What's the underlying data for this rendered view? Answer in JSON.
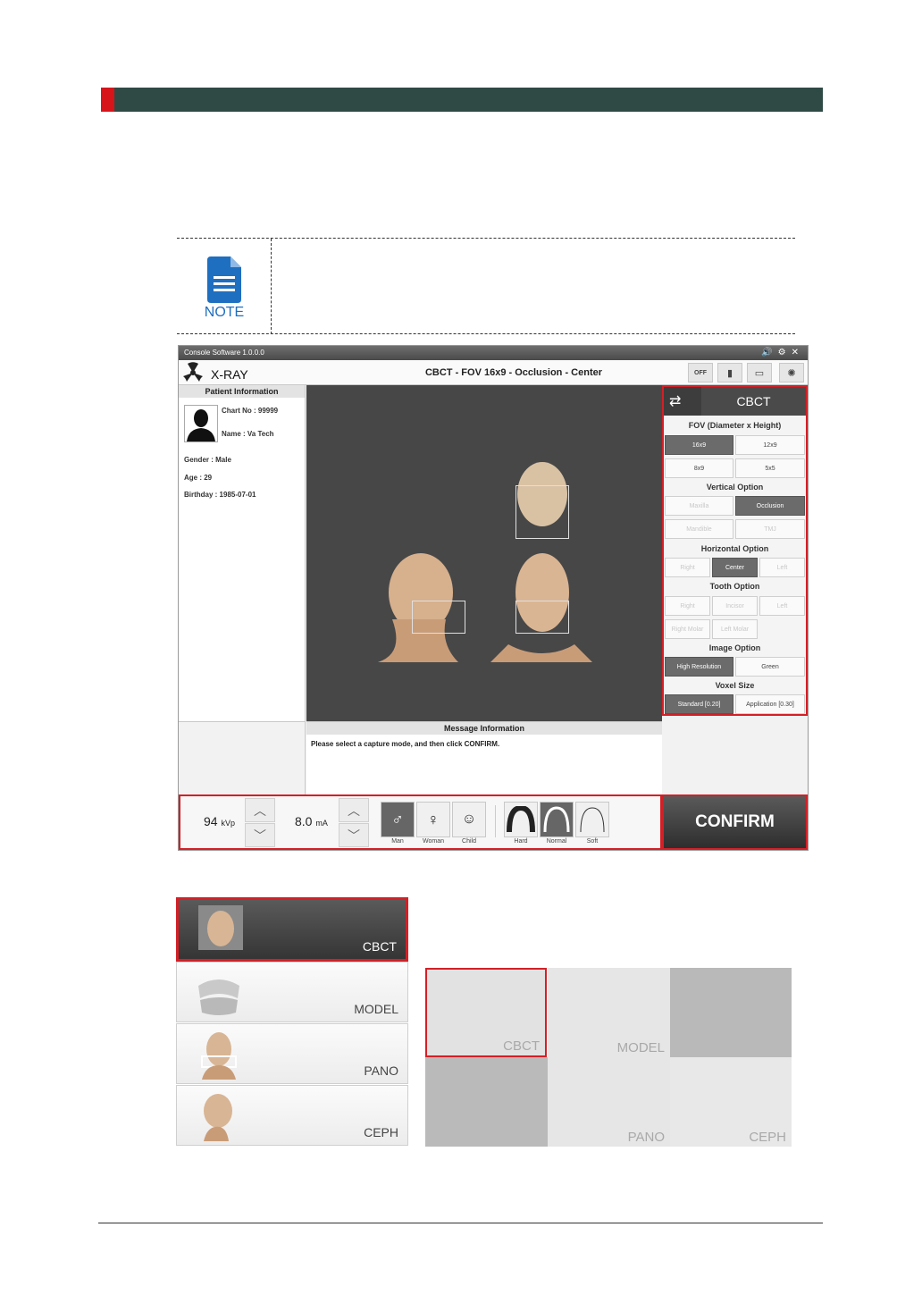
{
  "note": {
    "label": "NOTE"
  },
  "window": {
    "title": "Console Software  1.0.0.0",
    "app_name": "X-RAY",
    "mode_title": "CBCT - FOV 16x9 - Occlusion - Center",
    "header_buttons": [
      "OFF"
    ]
  },
  "patient": {
    "header": "Patient Information",
    "chart": "Chart No : 99999",
    "name": "Name : Va Tech",
    "gender": "Gender : Male",
    "age": "Age : 29",
    "birthday": "Birthday : 1985-07-01"
  },
  "control": {
    "mode": "CBCT",
    "fov_label": "FOV (Diameter x Height)",
    "fov": [
      "16x9",
      "12x9",
      "8x9",
      "5x5"
    ],
    "vertical_label": "Vertical Option",
    "vertical": [
      "Maxilla",
      "Occlusion",
      "Mandible",
      "TMJ"
    ],
    "horizontal_label": "Horizontal Option",
    "horizontal": [
      "Right",
      "Center",
      "Left"
    ],
    "tooth_label": "Tooth Option",
    "tooth": [
      "Right",
      "Incisor",
      "Left",
      "Right Molar",
      "Left Molar"
    ],
    "image_label": "Image Option",
    "image": [
      "High Resolution",
      "Green"
    ],
    "voxel_label": "Voxel Size",
    "voxel": [
      "Standard  [0.20]",
      "Application [0.30]"
    ]
  },
  "message": {
    "header": "Message Information",
    "text": "Please select a capture mode, and then click CONFIRM."
  },
  "bottom": {
    "kvp_value": "94",
    "kvp_unit": "kVp",
    "ma_value": "8.0",
    "ma_unit": "mA",
    "patient_types": [
      "Man",
      "Woman",
      "Child"
    ],
    "arch_types": [
      "Hard",
      "Normal",
      "Soft"
    ],
    "confirm": "CONFIRM"
  },
  "modes": [
    "CBCT",
    "MODEL",
    "PANO",
    "CEPH"
  ],
  "grid_modes": [
    "CBCT",
    "MODEL",
    "PANO",
    "CEPH"
  ]
}
